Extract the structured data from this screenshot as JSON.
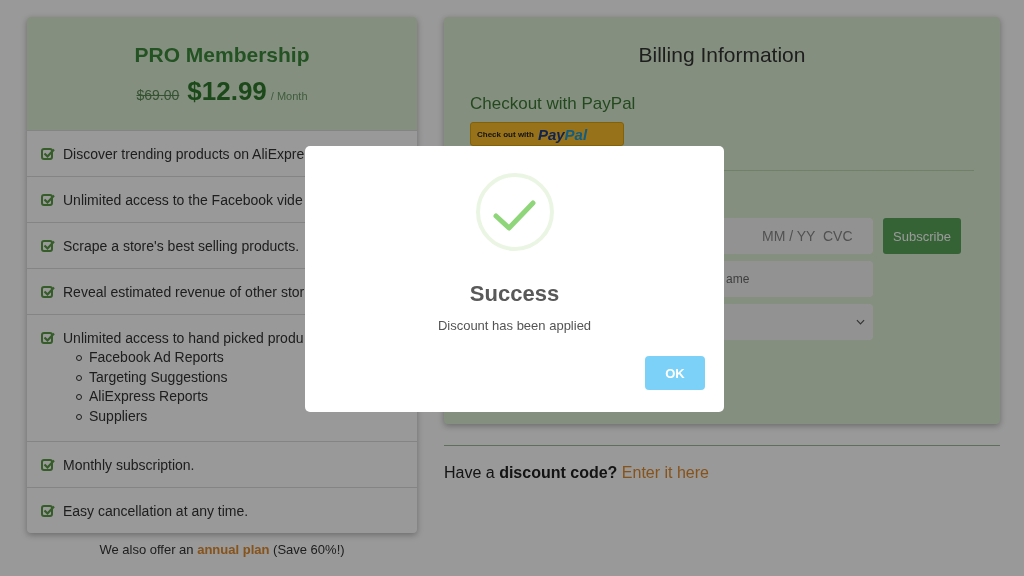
{
  "plan": {
    "title": "PRO Membership",
    "old_price": "$69.00",
    "price": "$12.99",
    "period": "/ Month",
    "features": [
      {
        "text": "Discover trending products on AliExpre",
        "checked": true
      },
      {
        "text": "Unlimited access to the Facebook vide",
        "checked": true
      },
      {
        "text": "Scrape a store's best selling products.",
        "checked": true
      },
      {
        "text": "Reveal estimated revenue of other stor",
        "checked": true
      },
      {
        "text": "Unlimited access to hand picked produ",
        "checked": true,
        "subitems": [
          "Facebook Ad Reports",
          "Targeting Suggestions",
          "AliExpress Reports",
          "Suppliers"
        ]
      },
      {
        "text": "Monthly subscription.",
        "checked": true
      },
      {
        "text": "Easy cancellation at any time.",
        "checked": true
      }
    ]
  },
  "annual_note": {
    "prefix": "We also offer an",
    "link": "annual plan",
    "suffix": "(Save 60%!)"
  },
  "billing": {
    "title": "Billing Information",
    "paypal_heading": "Checkout with PayPal",
    "paypal_button": {
      "label": "Check out with",
      "brand_dark": "Pay",
      "brand_light": "Pal"
    },
    "card_field": {
      "placeholder": "MM / YY  CVC"
    },
    "name_field": {
      "placeholder": "ame"
    },
    "subscribe": "Subscribe"
  },
  "discount": {
    "text": "Have a **discount code?**",
    "link": "Enter it here"
  },
  "modal": {
    "title": "Success",
    "message": "Discount has been applied",
    "button": "OK"
  }
}
